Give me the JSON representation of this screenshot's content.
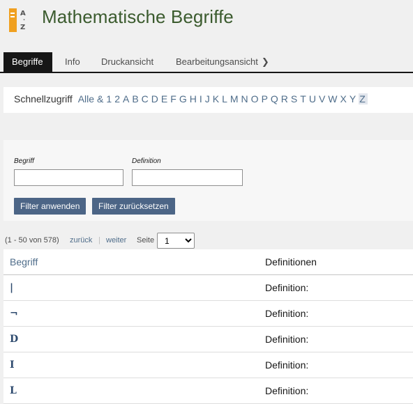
{
  "header": {
    "title": "Mathematische Begriffe",
    "logo_letters": [
      "A",
      "Z"
    ]
  },
  "tabs": [
    {
      "label": "Begriffe",
      "active": true
    },
    {
      "label": "Info",
      "active": false
    },
    {
      "label": "Druckansicht",
      "active": false
    },
    {
      "label": "Bearbeitungsansicht",
      "active": false
    }
  ],
  "quick_access": {
    "label": "Schnellzugriff",
    "links": [
      "Alle",
      "&",
      "1",
      "2",
      "A",
      "B",
      "C",
      "D",
      "E",
      "F",
      "G",
      "H",
      "I",
      "J",
      "K",
      "L",
      "M",
      "N",
      "O",
      "P",
      "Q",
      "R",
      "S",
      "T",
      "U",
      "V",
      "W",
      "X",
      "Y",
      "Z"
    ]
  },
  "filter": {
    "begriff_label": "Begriff",
    "begriff_value": "",
    "definition_label": "Definition",
    "definition_value": "",
    "apply_label": "Filter anwenden",
    "reset_label": "Filter zurücksetzen"
  },
  "pagination": {
    "range": "(1 - 50 von 578)",
    "prev": "zurück",
    "separator": "|",
    "next": "weiter",
    "page_label": "Seite",
    "page_value": "1"
  },
  "table": {
    "headers": [
      "Begriff",
      "Definitionen"
    ],
    "rows": [
      {
        "term": "|",
        "definition": "Definition:"
      },
      {
        "term": "¬",
        "definition": "Definition:"
      },
      {
        "term": "D",
        "definition": "Definition:"
      },
      {
        "term": "I",
        "definition": "Definition:"
      },
      {
        "term": "L",
        "definition": "Definition:"
      }
    ]
  },
  "colors": {
    "title": "#3b5b2e",
    "link": "#4f6d8a",
    "button": "#4c6586",
    "logo": "#f0a020"
  }
}
